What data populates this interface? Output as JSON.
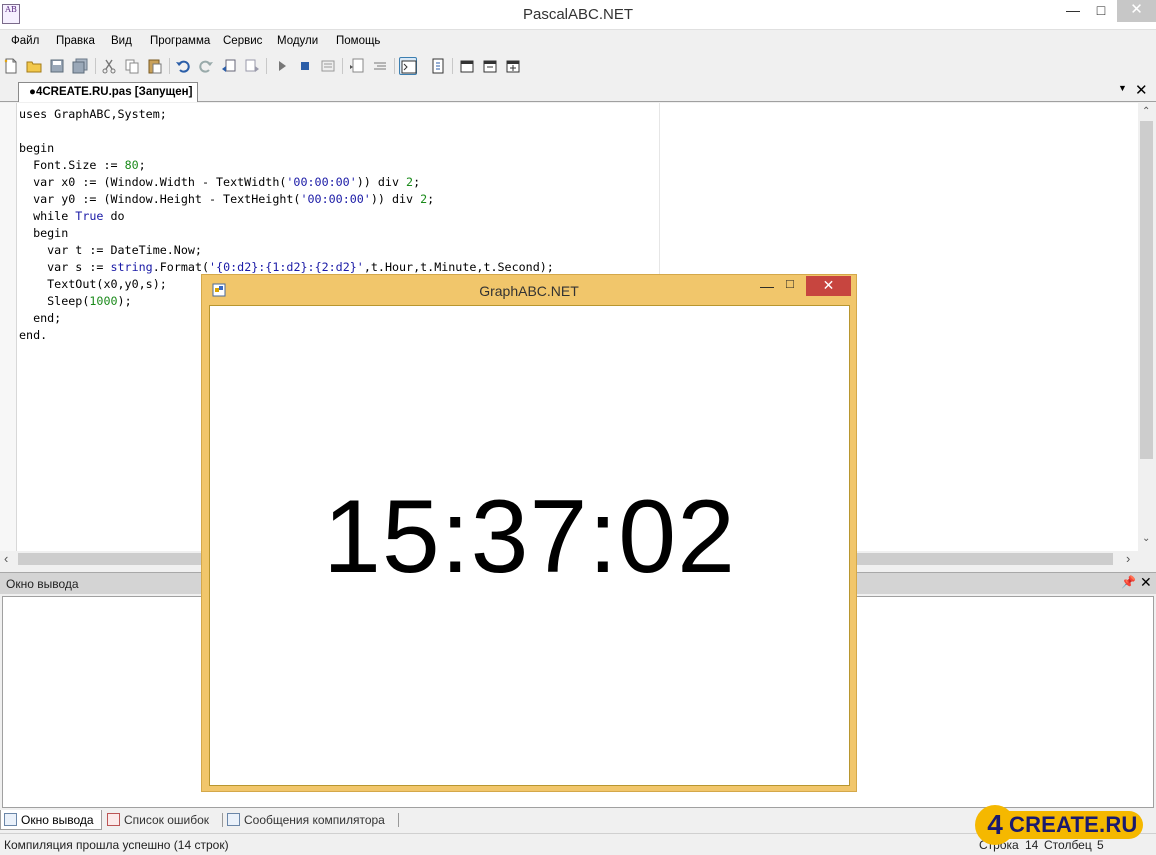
{
  "window": {
    "title": "PascalABC.NET",
    "app_icon_text": "AB",
    "min_icon": "minimize-icon",
    "max_icon": "maximize-icon",
    "close_icon": "close-icon"
  },
  "menu": [
    "Файл",
    "Правка",
    "Вид",
    "Программа",
    "Сервис",
    "Модули",
    "Помощь"
  ],
  "toolbar": {
    "icons": [
      "new-file-icon",
      "open-folder-icon",
      "save-icon",
      "save-all-icon",
      "cut-icon",
      "copy-icon",
      "paste-icon",
      "undo-icon",
      "redo-icon",
      "back-icon",
      "forward-icon",
      "run-icon",
      "stop-icon",
      "debug-icon",
      "indent-icon",
      "unindent-icon",
      "console-icon",
      "compile-icon",
      "step-over-icon",
      "step-into-icon",
      "step-out-icon"
    ],
    "active": "console-icon"
  },
  "editor": {
    "tab_label": "●4CREATE.RU.pas [Запущен]",
    "code_lines": [
      [
        {
          "t": "uses GraphABC,System;"
        }
      ],
      [
        {
          "t": ""
        }
      ],
      [
        {
          "t": "begin"
        }
      ],
      [
        {
          "t": "  Font.Size := "
        },
        {
          "t": "80",
          "c": "num"
        },
        {
          "t": ";"
        }
      ],
      [
        {
          "t": "  var x0 := (Window.Width - TextWidth("
        },
        {
          "t": "'00:00:00'",
          "c": "str"
        },
        {
          "t": ")) div "
        },
        {
          "t": "2",
          "c": "num"
        },
        {
          "t": ";"
        }
      ],
      [
        {
          "t": "  var y0 := (Window.Height - TextHeight("
        },
        {
          "t": "'00:00:00'",
          "c": "str"
        },
        {
          "t": ")) div "
        },
        {
          "t": "2",
          "c": "num"
        },
        {
          "t": ";"
        }
      ],
      [
        {
          "t": "  while "
        },
        {
          "t": "True",
          "c": "kw2"
        },
        {
          "t": " do"
        }
      ],
      [
        {
          "t": "  begin"
        }
      ],
      [
        {
          "t": "    var t := DateTime.Now;"
        }
      ],
      [
        {
          "t": "    var s := "
        },
        {
          "t": "string",
          "c": "kw2"
        },
        {
          "t": ".Format("
        },
        {
          "t": "'{0:d2}:{1:d2}:{2:d2}'",
          "c": "str"
        },
        {
          "t": ",t.Hour,t.Minute,t.Second);"
        }
      ],
      [
        {
          "t": "    TextOut(x0,y0,s);"
        }
      ],
      [
        {
          "t": "    Sleep("
        },
        {
          "t": "1000",
          "c": "num"
        },
        {
          "t": ");"
        }
      ],
      [
        {
          "t": "  end;"
        }
      ],
      [
        {
          "t": "end."
        }
      ]
    ]
  },
  "output_panel": {
    "title": "Окно вывода",
    "pin_icon": "pin-icon",
    "close_icon": "close-icon"
  },
  "bottom_tabs": [
    "Окно вывода",
    "Список ошибок",
    "Сообщения компилятора"
  ],
  "status": {
    "message": "Компиляция прошла успешно (14 строк)",
    "row_label": "Строка",
    "row_value": "14",
    "col_label": "Столбец",
    "col_value": "5"
  },
  "graph_window": {
    "title": "GraphABC.NET",
    "clock": "15:37:02"
  },
  "watermark": {
    "circle_text": "4",
    "text": "CREATE.RU"
  },
  "colors": {
    "graph_frame": "#f1c66b",
    "close_red": "#c7453f",
    "watermark": "#f5b800"
  }
}
